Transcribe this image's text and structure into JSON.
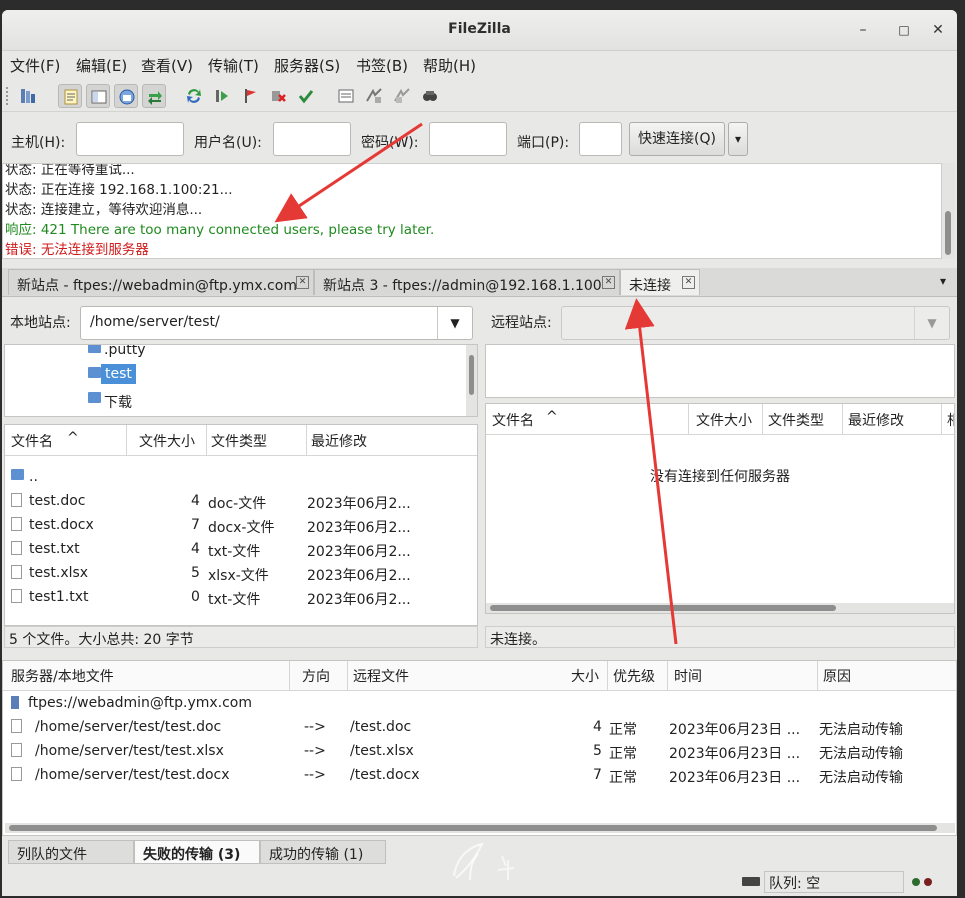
{
  "window": {
    "title": "FileZilla",
    "minimize": "–",
    "maximize": "□",
    "close": "✕"
  },
  "menu": [
    "文件(F)",
    "编辑(E)",
    "查看(V)",
    "传输(T)",
    "服务器(S)",
    "书签(B)",
    "帮助(H)"
  ],
  "quickconnect": {
    "host_label": "主机(H):",
    "user_label": "用户名(U):",
    "pass_label": "密码(W):",
    "port_label": "端口(P):",
    "connect_button": "快速连接(Q)",
    "dropdown": "▾",
    "host_value": "",
    "user_value": "",
    "pass_value": "",
    "port_value": ""
  },
  "log": [
    {
      "text": "状态: 正在等待重试...",
      "type": "status"
    },
    {
      "text": "状态: 正在连接 192.168.1.100:21...",
      "type": "status"
    },
    {
      "text": "状态: 连接建立，等待欢迎消息...",
      "type": "status"
    },
    {
      "text": "响应: 421 There are too many connected users, please try later.",
      "type": "response"
    },
    {
      "text": "错误: 无法连接到服务器",
      "type": "error"
    }
  ],
  "tabs": [
    {
      "label": "新站点 - ftpes://webadmin@ftp.ymx.com",
      "close": "✕"
    },
    {
      "label": "新站点 3 - ftpes://admin@192.168.1.100",
      "close": "✕"
    },
    {
      "label": "未连接",
      "close": "✕"
    }
  ],
  "tabs_menu": "▾",
  "local": {
    "site_label": "本地站点:",
    "path": "/home/server/test/",
    "tree": [
      ".putty",
      "test",
      "下载"
    ],
    "headers": {
      "name": "文件名",
      "size": "文件大小",
      "type": "文件类型",
      "modified": "最近修改"
    },
    "sort_arrow": "^",
    "parent": "..",
    "files": [
      {
        "name": "test.doc",
        "size": "4",
        "type": "doc-文件",
        "modified": "2023年06月2..."
      },
      {
        "name": "test.docx",
        "size": "7",
        "type": "docx-文件",
        "modified": "2023年06月2..."
      },
      {
        "name": "test.txt",
        "size": "4",
        "type": "txt-文件",
        "modified": "2023年06月2..."
      },
      {
        "name": "test.xlsx",
        "size": "5",
        "type": "xlsx-文件",
        "modified": "2023年06月2..."
      },
      {
        "name": "test1.txt",
        "size": "0",
        "type": "txt-文件",
        "modified": "2023年06月2..."
      }
    ],
    "status": "5 个文件。大小总共: 20 字节"
  },
  "remote": {
    "site_label": "远程站点:",
    "path": "",
    "headers": {
      "name": "文件名",
      "size": "文件大小",
      "type": "文件类型",
      "modified": "最近修改",
      "perm": "相"
    },
    "sort_arrow": "^",
    "empty_message": "没有连接到任何服务器",
    "status": "未连接。"
  },
  "queue": {
    "headers": {
      "server": "服务器/本地文件",
      "direction": "方向",
      "remote": "远程文件",
      "size": "大小",
      "priority": "优先级",
      "time": "时间",
      "reason": "原因"
    },
    "server": "ftpes://webadmin@ftp.ymx.com",
    "items": [
      {
        "local": "/home/server/test/test.doc",
        "dir": "-->",
        "remote": "/test.doc",
        "size": "4",
        "priority": "正常",
        "time": "2023年06月23日 ...",
        "reason": "无法启动传输"
      },
      {
        "local": "/home/server/test/test.xlsx",
        "dir": "-->",
        "remote": "/test.xlsx",
        "size": "5",
        "priority": "正常",
        "time": "2023年06月23日 ...",
        "reason": "无法启动传输"
      },
      {
        "local": "/home/server/test/test.docx",
        "dir": "-->",
        "remote": "/test.docx",
        "size": "7",
        "priority": "正常",
        "time": "2023年06月23日 ...",
        "reason": "无法启动传输"
      }
    ]
  },
  "bottom_tabs": [
    "列队的文件",
    "失败的传输 (3)",
    "成功的传输 (1)"
  ],
  "statusbar": {
    "queue": "队列: 空"
  },
  "colors": {
    "accent": "#4a90d9",
    "log_response": "#1f8a1f",
    "log_error": "#d01b1b",
    "annotation_arrow": "#e53935"
  }
}
